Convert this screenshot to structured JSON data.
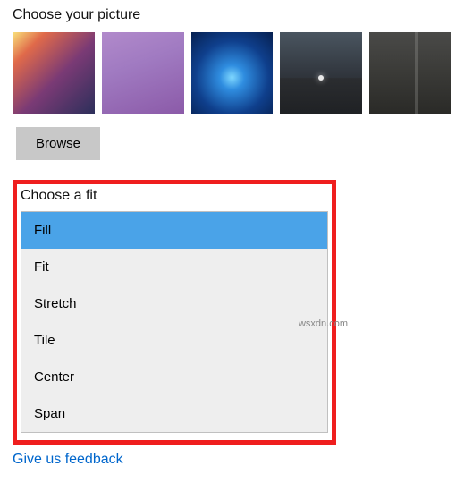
{
  "picture_section": {
    "label": "Choose your picture",
    "browse_label": "Browse",
    "thumbnails": [
      "gradient-warm",
      "gradient-purple",
      "windows-light",
      "moon-mountain",
      "cliff-rock"
    ]
  },
  "fit_section": {
    "label": "Choose a fit",
    "options": [
      "Fill",
      "Fit",
      "Stretch",
      "Tile",
      "Center",
      "Span"
    ],
    "selected_index": 0
  },
  "feedback_link": "Give us feedback",
  "watermark": "wsxdn.com"
}
